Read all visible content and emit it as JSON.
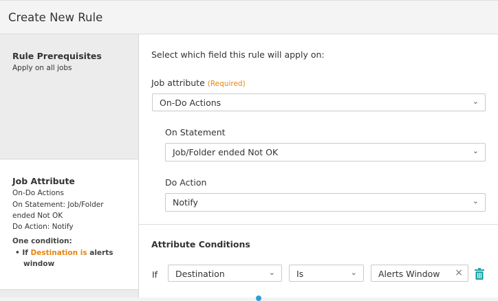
{
  "header": {
    "title": "Create New Rule"
  },
  "sidebar": {
    "prerequisites": {
      "title": "Rule Prerequisites",
      "text": "Apply on all jobs"
    },
    "job_attribute": {
      "title": "Job Attribute",
      "lines": [
        "On-Do Actions",
        "On Statement: Job/Folder",
        "ended Not OK",
        "Do Action: Notify"
      ],
      "condition_title": "One condition:",
      "condition": {
        "prefix": "If ",
        "field": "Destination is",
        "suffix": " alerts",
        "line2": "window"
      }
    }
  },
  "main": {
    "intro": "Select which field this rule will apply on:",
    "job_attribute": {
      "label": "Job attribute",
      "required": "(Required)",
      "value": "On-Do Actions"
    },
    "on_statement": {
      "label": "On Statement",
      "value": "Job/Folder ended Not OK"
    },
    "do_action": {
      "label": "Do Action",
      "value": "Notify"
    },
    "conditions": {
      "title": "Attribute Conditions",
      "if_label": "If",
      "field": "Destination",
      "operator": "Is",
      "value": "Alerts Window"
    }
  },
  "colors": {
    "accent": "#e8830c",
    "trash": "#1aa3a3"
  },
  "icons": [
    "chevron-down-icon",
    "close-icon",
    "trash-icon"
  ]
}
